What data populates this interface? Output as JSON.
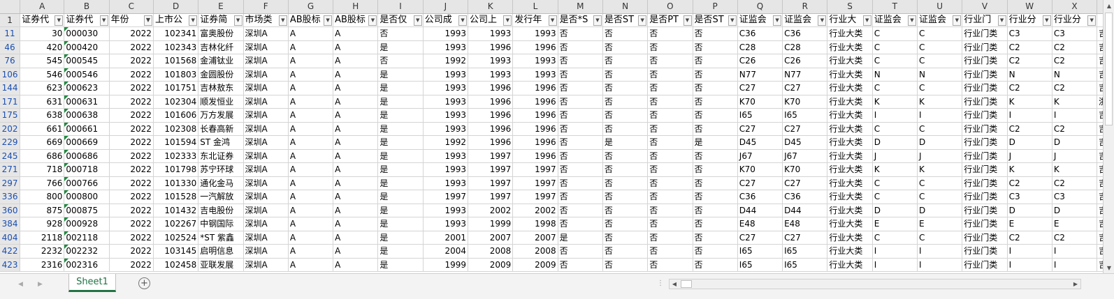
{
  "columns": [
    "A",
    "B",
    "C",
    "D",
    "E",
    "F",
    "G",
    "H",
    "I",
    "J",
    "K",
    "L",
    "M",
    "N",
    "O",
    "P",
    "Q",
    "R",
    "S",
    "T",
    "U",
    "V",
    "W",
    "X"
  ],
  "header_row_number": "1",
  "headers": [
    "证券代",
    "证券代",
    "年份",
    "上市公",
    "证券简",
    "市场类",
    "AB股标",
    "AB股标",
    "是否仅",
    "公司成",
    "公司上",
    "发行年",
    "是否*S",
    "是否ST",
    "是否PT",
    "是否ST",
    "证监会",
    "证监会",
    "行业大",
    "证监会",
    "证监会",
    "行业门",
    "行业分",
    "行业分"
  ],
  "rows": [
    {
      "n": "11",
      "c": [
        "30",
        "000030",
        "2022",
        "102341",
        "富奥股份",
        "深圳A",
        "A",
        "A",
        "否",
        "1993",
        "1993",
        "1993",
        "否",
        "否",
        "否",
        "否",
        "C36",
        "C36",
        "行业大类",
        "C",
        "C",
        "行业门类",
        "C3",
        "C3",
        "吉"
      ]
    },
    {
      "n": "46",
      "c": [
        "420",
        "000420",
        "2022",
        "102343",
        "吉林化纤",
        "深圳A",
        "A",
        "A",
        "是",
        "1993",
        "1996",
        "1996",
        "否",
        "否",
        "否",
        "否",
        "C28",
        "C28",
        "行业大类",
        "C",
        "C",
        "行业门类",
        "C2",
        "C2",
        "吉"
      ]
    },
    {
      "n": "76",
      "c": [
        "545",
        "000545",
        "2022",
        "101568",
        "金浦钛业",
        "深圳A",
        "A",
        "A",
        "否",
        "1992",
        "1993",
        "1993",
        "否",
        "否",
        "否",
        "否",
        "C26",
        "C26",
        "行业大类",
        "C",
        "C",
        "行业门类",
        "C2",
        "C2",
        "吉"
      ]
    },
    {
      "n": "106",
      "c": [
        "546",
        "000546",
        "2022",
        "101803",
        "金圆股份",
        "深圳A",
        "A",
        "A",
        "是",
        "1993",
        "1993",
        "1993",
        "否",
        "否",
        "否",
        "否",
        "N77",
        "N77",
        "行业大类",
        "N",
        "N",
        "行业门类",
        "N",
        "N",
        "吉"
      ]
    },
    {
      "n": "144",
      "c": [
        "623",
        "000623",
        "2022",
        "101751",
        "吉林敖东",
        "深圳A",
        "A",
        "A",
        "是",
        "1993",
        "1996",
        "1996",
        "否",
        "否",
        "否",
        "否",
        "C27",
        "C27",
        "行业大类",
        "C",
        "C",
        "行业门类",
        "C2",
        "C2",
        "吉"
      ]
    },
    {
      "n": "171",
      "c": [
        "631",
        "000631",
        "2022",
        "102304",
        "顺发恒业",
        "深圳A",
        "A",
        "A",
        "是",
        "1993",
        "1996",
        "1996",
        "否",
        "否",
        "否",
        "否",
        "K70",
        "K70",
        "行业大类",
        "K",
        "K",
        "行业门类",
        "K",
        "K",
        "浙"
      ]
    },
    {
      "n": "175",
      "c": [
        "638",
        "000638",
        "2022",
        "101606",
        "万方发展",
        "深圳A",
        "A",
        "A",
        "是",
        "1993",
        "1996",
        "1996",
        "否",
        "否",
        "否",
        "否",
        "I65",
        "I65",
        "行业大类",
        "I",
        "I",
        "行业门类",
        "I",
        "I",
        "吉"
      ]
    },
    {
      "n": "202",
      "c": [
        "661",
        "000661",
        "2022",
        "102308",
        "长春高新",
        "深圳A",
        "A",
        "A",
        "是",
        "1993",
        "1996",
        "1996",
        "否",
        "否",
        "否",
        "否",
        "C27",
        "C27",
        "行业大类",
        "C",
        "C",
        "行业门类",
        "C2",
        "C2",
        "吉"
      ]
    },
    {
      "n": "229",
      "c": [
        "669",
        "000669",
        "2022",
        "101594",
        "ST 金鸿",
        "深圳A",
        "A",
        "A",
        "是",
        "1992",
        "1996",
        "1996",
        "否",
        "是",
        "否",
        "是",
        "D45",
        "D45",
        "行业大类",
        "D",
        "D",
        "行业门类",
        "D",
        "D",
        "吉"
      ]
    },
    {
      "n": "245",
      "c": [
        "686",
        "000686",
        "2022",
        "102333",
        "东北证券",
        "深圳A",
        "A",
        "A",
        "是",
        "1993",
        "1997",
        "1996",
        "否",
        "否",
        "否",
        "否",
        "J67",
        "J67",
        "行业大类",
        "J",
        "J",
        "行业门类",
        "J",
        "J",
        "吉"
      ]
    },
    {
      "n": "271",
      "c": [
        "718",
        "000718",
        "2022",
        "101798",
        "苏宁环球",
        "深圳A",
        "A",
        "A",
        "是",
        "1993",
        "1997",
        "1997",
        "否",
        "否",
        "否",
        "否",
        "K70",
        "K70",
        "行业大类",
        "K",
        "K",
        "行业门类",
        "K",
        "K",
        "吉"
      ]
    },
    {
      "n": "297",
      "c": [
        "766",
        "000766",
        "2022",
        "101330",
        "通化金马",
        "深圳A",
        "A",
        "A",
        "是",
        "1993",
        "1997",
        "1997",
        "否",
        "否",
        "否",
        "否",
        "C27",
        "C27",
        "行业大类",
        "C",
        "C",
        "行业门类",
        "C2",
        "C2",
        "吉"
      ]
    },
    {
      "n": "336",
      "c": [
        "800",
        "000800",
        "2022",
        "101528",
        "一汽解放",
        "深圳A",
        "A",
        "A",
        "是",
        "1997",
        "1997",
        "1997",
        "否",
        "否",
        "否",
        "否",
        "C36",
        "C36",
        "行业大类",
        "C",
        "C",
        "行业门类",
        "C3",
        "C3",
        "吉"
      ]
    },
    {
      "n": "360",
      "c": [
        "875",
        "000875",
        "2022",
        "101432",
        "吉电股份",
        "深圳A",
        "A",
        "A",
        "是",
        "1993",
        "2002",
        "2002",
        "否",
        "否",
        "否",
        "否",
        "D44",
        "D44",
        "行业大类",
        "D",
        "D",
        "行业门类",
        "D",
        "D",
        "吉"
      ]
    },
    {
      "n": "384",
      "c": [
        "928",
        "000928",
        "2022",
        "102267",
        "中钢国际",
        "深圳A",
        "A",
        "A",
        "是",
        "1993",
        "1999",
        "1998",
        "否",
        "否",
        "否",
        "否",
        "E48",
        "E48",
        "行业大类",
        "E",
        "E",
        "行业门类",
        "E",
        "E",
        "吉"
      ]
    },
    {
      "n": "404",
      "c": [
        "2118",
        "002118",
        "2022",
        "102524",
        "*ST 紫鑫",
        "深圳A",
        "A",
        "A",
        "是",
        "2001",
        "2007",
        "2007",
        "是",
        "否",
        "否",
        "否",
        "C27",
        "C27",
        "行业大类",
        "C",
        "C",
        "行业门类",
        "C2",
        "C2",
        "吉"
      ]
    },
    {
      "n": "422",
      "c": [
        "2232",
        "002232",
        "2022",
        "103145",
        "启明信息",
        "深圳A",
        "A",
        "A",
        "是",
        "2004",
        "2008",
        "2008",
        "否",
        "否",
        "否",
        "否",
        "I65",
        "I65",
        "行业大类",
        "I",
        "I",
        "行业门类",
        "I",
        "I",
        "吉"
      ]
    },
    {
      "n": "423",
      "c": [
        "2316",
        "002316",
        "2022",
        "102458",
        "亚联发展",
        "深圳A",
        "A",
        "A",
        "是",
        "1999",
        "2009",
        "2009",
        "否",
        "否",
        "否",
        "否",
        "I65",
        "I65",
        "行业大类",
        "I",
        "I",
        "行业门类",
        "I",
        "I",
        "吉"
      ]
    }
  ],
  "sheet_tab": "Sheet1",
  "add_sheet_symbol": "+",
  "icons": {
    "filter": "filter-dropdown-icon",
    "filter_active": "filter-active-icon",
    "scroll_up": "scroll-up-icon",
    "scroll_down": "scroll-down-icon",
    "scroll_left": "scroll-left-icon",
    "scroll_right": "scroll-right-icon",
    "tab_prev": "tab-prev-icon",
    "tab_next": "tab-next-icon"
  },
  "colors": {
    "accent_green": "#217346",
    "row_number_blue": "#1a4fb0",
    "header_gray": "#e6e6e6",
    "gridline": "#d4d4d4"
  }
}
